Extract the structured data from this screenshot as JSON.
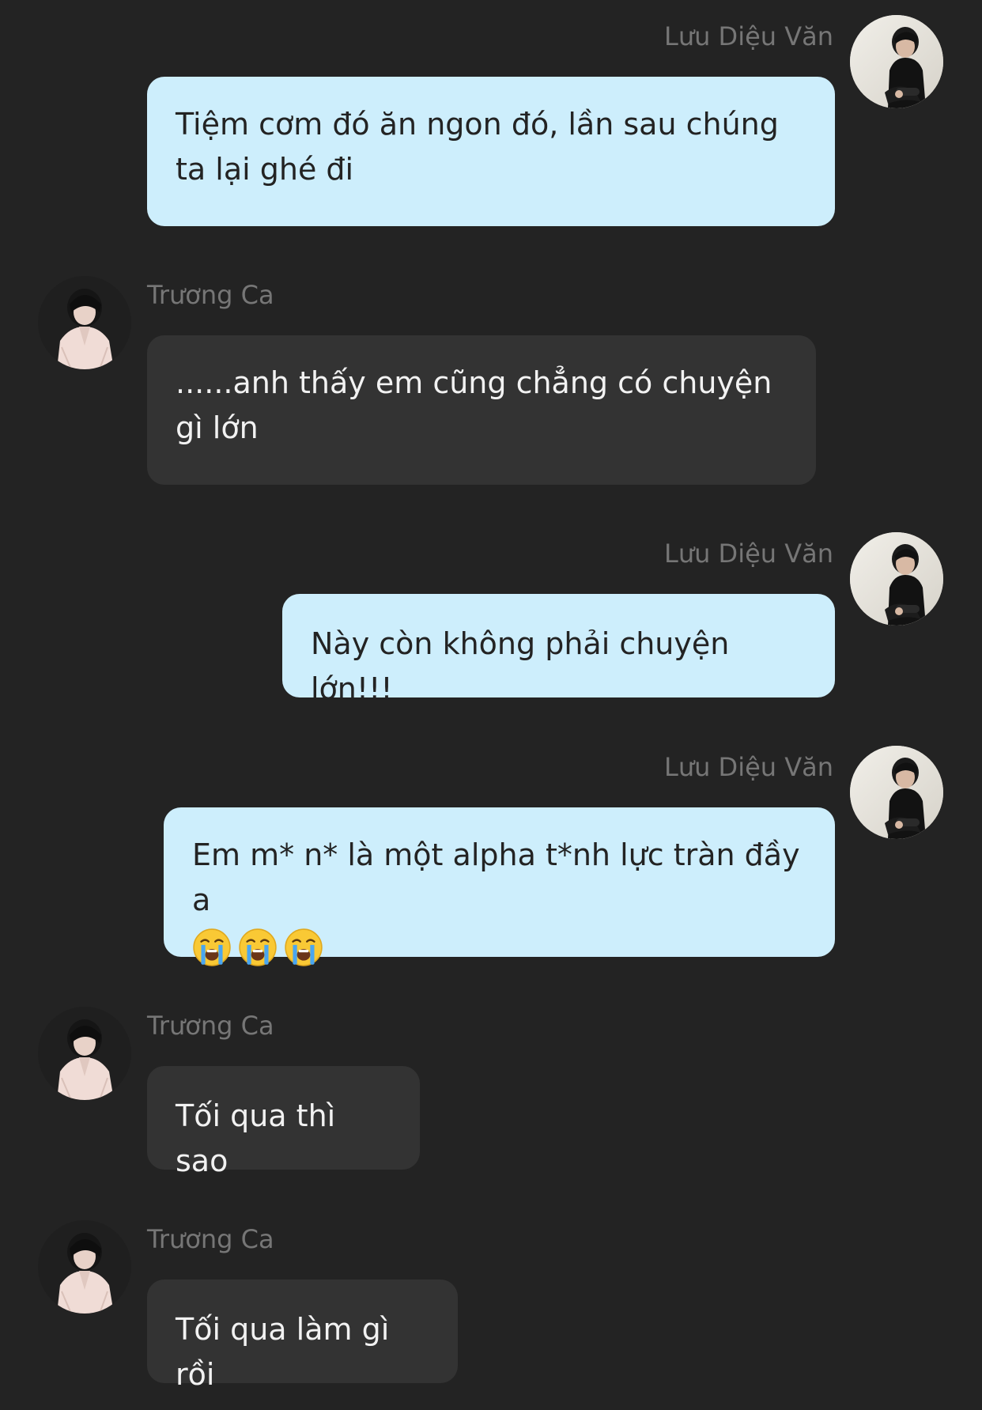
{
  "chat": {
    "messages": [
      {
        "sender": "Lưu Diệu Văn",
        "text": "Tiệm cơm đó ăn ngon đó, lần sau chúng ta lại ghé đi",
        "avatar": "user-avatar-luu-dieu-van"
      },
      {
        "sender": "Trương Ca",
        "text": "......anh thấy em cũng chẳng có chuyện gì lớn",
        "avatar": "user-avatar-truong-ca"
      },
      {
        "sender": "Lưu Diệu Văn",
        "text": "Này còn không phải chuyện lớn!!!",
        "avatar": "user-avatar-luu-dieu-van"
      },
      {
        "sender": "Lưu Diệu Văn",
        "text": "Em m* n* là một alpha t*nh lực tràn đầy a",
        "emojis": [
          "loudly-crying-face-icon",
          "loudly-crying-face-icon",
          "loudly-crying-face-icon"
        ],
        "avatar": "user-avatar-luu-dieu-van"
      },
      {
        "sender": "Trương Ca",
        "text": "Tối qua thì sao",
        "avatar": "user-avatar-truong-ca"
      },
      {
        "sender": "Trương Ca",
        "text": "Tối qua làm gì rồi",
        "avatar": "user-avatar-truong-ca"
      }
    ]
  },
  "colors": {
    "background": "#232323",
    "outgoing_bubble": "#cdeefc",
    "incoming_bubble": "#333333",
    "sender_name": "#767676"
  }
}
